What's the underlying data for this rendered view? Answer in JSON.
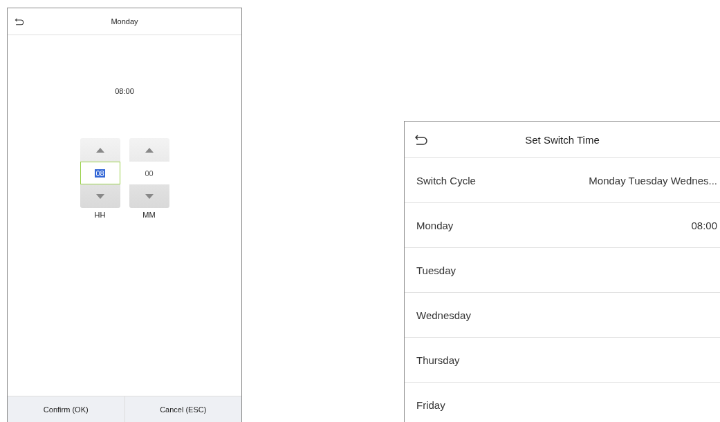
{
  "time_dialog": {
    "title": "Monday",
    "time": "08:00",
    "spinners": [
      {
        "label": "HH",
        "value": "08",
        "selected": true
      },
      {
        "label": "MM",
        "value": "00",
        "selected": false
      }
    ],
    "buttons": [
      "Confirm (OK)",
      "Cancel (ESC)"
    ]
  },
  "switch_time": {
    "title": "Set Switch Time",
    "rows": [
      {
        "label": "Switch Cycle",
        "value": "Monday Tuesday Wednes..."
      },
      {
        "label": "Monday",
        "value": "08:00"
      },
      {
        "label": "Tuesday"
      },
      {
        "label": "Wednesday"
      },
      {
        "label": "Thursday"
      },
      {
        "label": "Friday"
      }
    ]
  }
}
